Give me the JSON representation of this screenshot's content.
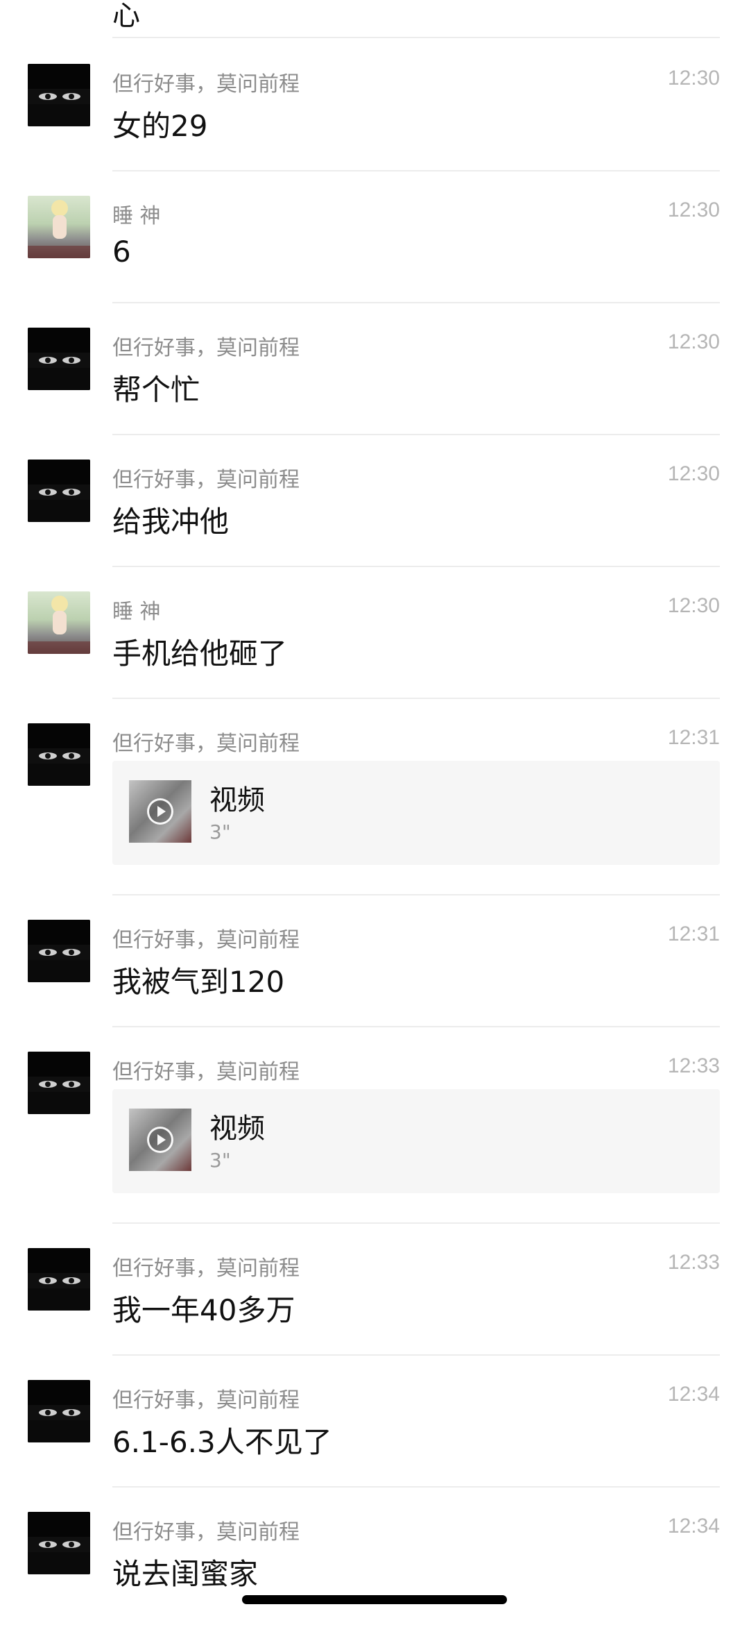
{
  "top_partial_text": "心",
  "messages": [
    {
      "sender": "但行好事，莫问前程",
      "time": "12:30",
      "text": "女的29"
    },
    {
      "sender": "睡 神",
      "time": "12:30",
      "text": "6"
    },
    {
      "sender": "但行好事，莫问前程",
      "time": "12:30",
      "text": "帮个忙"
    },
    {
      "sender": "但行好事，莫问前程",
      "time": "12:30",
      "text": "给我冲他"
    },
    {
      "sender": "睡 神",
      "time": "12:30",
      "text": "手机给他砸了"
    },
    {
      "sender": "但行好事，莫问前程",
      "time": "12:31",
      "video_label": "视频",
      "video_duration": "3\""
    },
    {
      "sender": "但行好事，莫问前程",
      "time": "12:31",
      "text": "我被气到120"
    },
    {
      "sender": "但行好事，莫问前程",
      "time": "12:33",
      "video_label": "视频",
      "video_duration": "3\""
    },
    {
      "sender": "但行好事，莫问前程",
      "time": "12:33",
      "text": "我一年40多万"
    },
    {
      "sender": "但行好事，莫问前程",
      "time": "12:34",
      "text": "6.1-6.3人不见了"
    },
    {
      "sender": "但行好事，莫问前程",
      "time": "12:34",
      "text": "说去闺蜜家"
    }
  ],
  "icons": {
    "play": "play-icon",
    "avatar_dark": "anime-girl-avatar",
    "avatar_light": "anime-child-avatar"
  },
  "colors": {
    "name": "#8c8c8c",
    "time": "#b5b5b5",
    "text": "#111111",
    "divider": "#ececec",
    "video_card_bg": "#f6f6f6"
  }
}
